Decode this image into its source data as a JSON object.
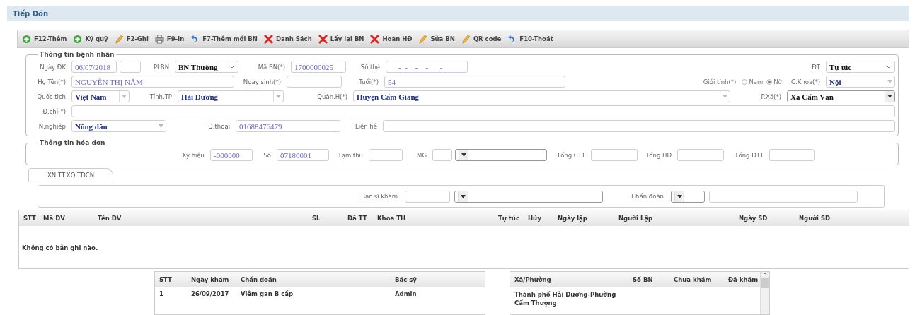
{
  "title": "Tiếp Đón",
  "toolbar": [
    {
      "label": "F12-Thêm",
      "kind": "add"
    },
    {
      "label": "Ký quỹ",
      "kind": "add"
    },
    {
      "label": "F2-Ghi",
      "kind": "edit"
    },
    {
      "label": "F9-In",
      "kind": "print"
    },
    {
      "label": "F7-Thêm mới BN",
      "kind": "back"
    },
    {
      "label": "Danh Sách",
      "kind": "delete"
    },
    {
      "label": "Lấy lại BN",
      "kind": "delete"
    },
    {
      "label": "Hoàn HĐ",
      "kind": "delete"
    },
    {
      "label": "Sửa BN",
      "kind": "edit"
    },
    {
      "label": "QR code",
      "kind": "edit"
    },
    {
      "label": "F10-Thoát",
      "kind": "back"
    }
  ],
  "patient": {
    "legend": "Thông tin bệnh nhân",
    "fields": [
      {
        "label": "Ngày ĐK",
        "kind": "text",
        "value": "06/07/2018"
      },
      {
        "kind": "text"
      },
      {
        "label": "PLBN",
        "kind": "select",
        "value": "BN Thường"
      },
      {
        "label": "Mã BN(*)",
        "kind": "text",
        "value": "1700000025"
      },
      {
        "label": "Số thẻ",
        "kind": "text",
        "placeholder": "__-_-__-__-___-_____"
      },
      {
        "label": "ĐT",
        "kind": "select",
        "value": "Tự túc"
      },
      {
        "label": "Họ Tên(*)",
        "kind": "text",
        "value": "NGUYỄN THỊ NĂM"
      },
      {
        "label": "Ngày sinh(*)",
        "kind": "text"
      },
      {
        "label": "Tuổi(*)",
        "kind": "text",
        "value": "54"
      },
      {
        "label": "Giới tính(*)",
        "kind": "radio",
        "options": [
          {
            "label": "Nam",
            "selected": false
          },
          {
            "label": "Nữ",
            "selected": true
          }
        ]
      },
      {
        "label": "C.Khoa(*)",
        "kind": "combo",
        "value": "Nội"
      },
      {
        "label": "Quốc tịch",
        "kind": "combo",
        "value": "Việt Nam"
      },
      {
        "label": "Tỉnh.TP",
        "kind": "combo",
        "value": "Hải Dương"
      },
      {
        "label": "Quận.H(*)",
        "kind": "combo",
        "value": "Huyện Cẩm Giàng"
      },
      {
        "label": "P.Xã(*)",
        "kind": "dropdown",
        "value": "Xã Cẩm Văn"
      },
      {
        "label": "Đ.chỉ(*)",
        "kind": "text"
      },
      {
        "label": "N.nghiệp",
        "kind": "combo",
        "value": "Nông dân"
      },
      {
        "label": "Đ.thoại",
        "kind": "text",
        "value": "01688476479"
      },
      {
        "label": "Liên hệ",
        "kind": "text"
      }
    ]
  },
  "invoice": {
    "legend": "Thông tin hóa đơn",
    "fields": [
      {
        "label": "Ký hiệu",
        "kind": "text",
        "value": "-000000"
      },
      {
        "label": "Số",
        "kind": "text",
        "value": "07180001"
      },
      {
        "label": "Tạm thu",
        "kind": "text"
      },
      {
        "label": "MG",
        "kind": "text"
      },
      {
        "kind": "dropdown"
      },
      {
        "label": "Tổng CTT",
        "kind": "text"
      },
      {
        "label": "Tổng HĐ",
        "kind": "text"
      },
      {
        "label": "Tổng ĐTT",
        "kind": "text"
      }
    ]
  },
  "tabs": [
    {
      "label": "XN.TT.XQ.TDCN",
      "selected": true
    }
  ],
  "exam": {
    "fields": [
      {
        "label": "Bác sĩ khám",
        "kind": "text"
      },
      {
        "kind": "dropdown"
      },
      {
        "label": "Chẩn đoán",
        "kind": "dropdown"
      },
      {
        "kind": "text"
      }
    ]
  },
  "services": {
    "columns": [
      "STT",
      "Mã DV",
      "Tên DV",
      "SL",
      "Đã TT",
      "Khoa TH",
      "Tự túc",
      "Hủy",
      "Ngày lập",
      "Người Lập",
      "Ngày SD",
      "Người SD"
    ],
    "empty_text": "Không có bản ghi nào."
  },
  "history": {
    "columns": [
      "STT",
      "Ngày khám",
      "Chẩn đoán",
      "Bác sỹ"
    ],
    "rows": [
      [
        "1",
        "26/09/2017",
        "Viêm gan B cấp",
        "Admin"
      ]
    ]
  },
  "wards": {
    "columns": [
      "Xã/Phường",
      "Số BN",
      "Chưa khám",
      "Đã khám"
    ],
    "rows": [
      [
        "Thành phố Hải Dương-Phường Cẩm Thượng",
        "",
        "",
        ""
      ]
    ]
  }
}
